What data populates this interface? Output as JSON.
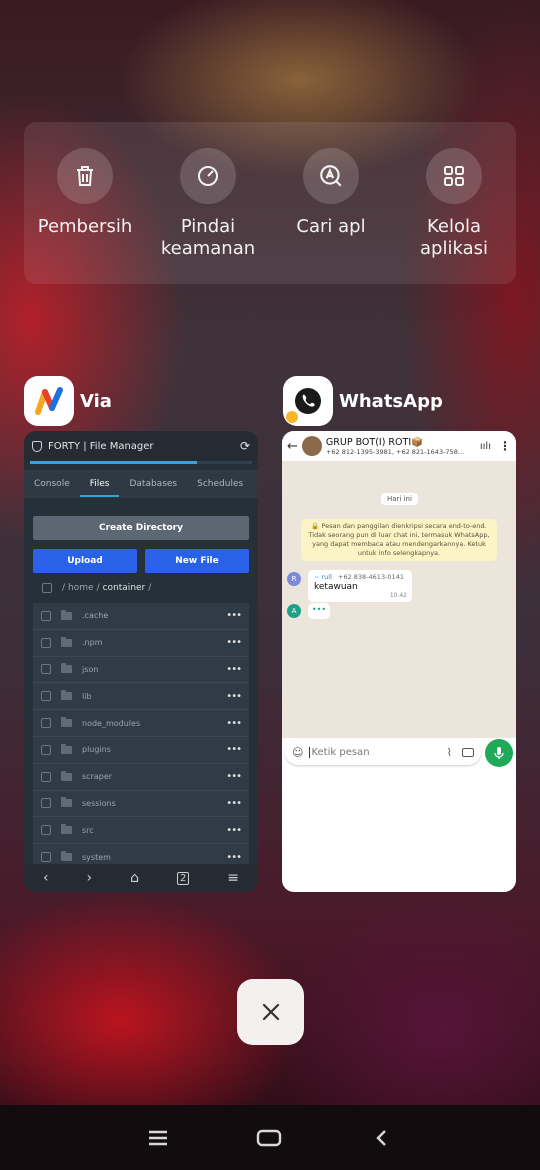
{
  "quick_actions": [
    {
      "label": "Pembersih",
      "icon": "trash-icon"
    },
    {
      "label": "Pindai\nkeamanan",
      "icon": "scan-icon"
    },
    {
      "label": "Cari apl",
      "icon": "search-app-icon"
    },
    {
      "label": "Kelola\naplikasi",
      "icon": "grid-icon"
    }
  ],
  "recent_apps": [
    {
      "name": "Via"
    },
    {
      "name": "WhatsApp"
    }
  ],
  "file_manager": {
    "title": "FORTY | File Manager",
    "tabs": [
      "Console",
      "Files",
      "Databases",
      "Schedules"
    ],
    "active_tab": "Files",
    "create_directory": "Create Directory",
    "upload": "Upload",
    "new_file": "New File",
    "breadcrumb": [
      "/",
      "home",
      "/",
      "container",
      "/"
    ],
    "folders": [
      ".cache",
      ".npm",
      "json",
      "lib",
      "node_modules",
      "plugins",
      "scraper",
      "sessions",
      "src",
      "system"
    ]
  },
  "whatsapp": {
    "group_name": "GRUP BOT(I) ROTI📦",
    "members": "+62 812-1395-3981, +62 821-1643-758…",
    "date_chip": "Hari ini",
    "encryption_notice": "🔒 Pesan dan panggilan dienkripsi secara end-to-end. Tidak seorang pun di luar chat ini, termasuk WhatsApp, yang dapat membaca atau mendengarkannya. Ketuk untuk info selengkapnya.",
    "message": {
      "avatar_letter": "R",
      "sender": "~ rull",
      "phone": "+62 838-4613-0141",
      "text": "ketawuan",
      "time": "10.42"
    },
    "typing_avatar": "A",
    "typing": "•••",
    "input_placeholder": "Ketik pesan"
  },
  "colors": {
    "accent_blue": "#2962e8",
    "whatsapp_green": "#1faa59"
  }
}
